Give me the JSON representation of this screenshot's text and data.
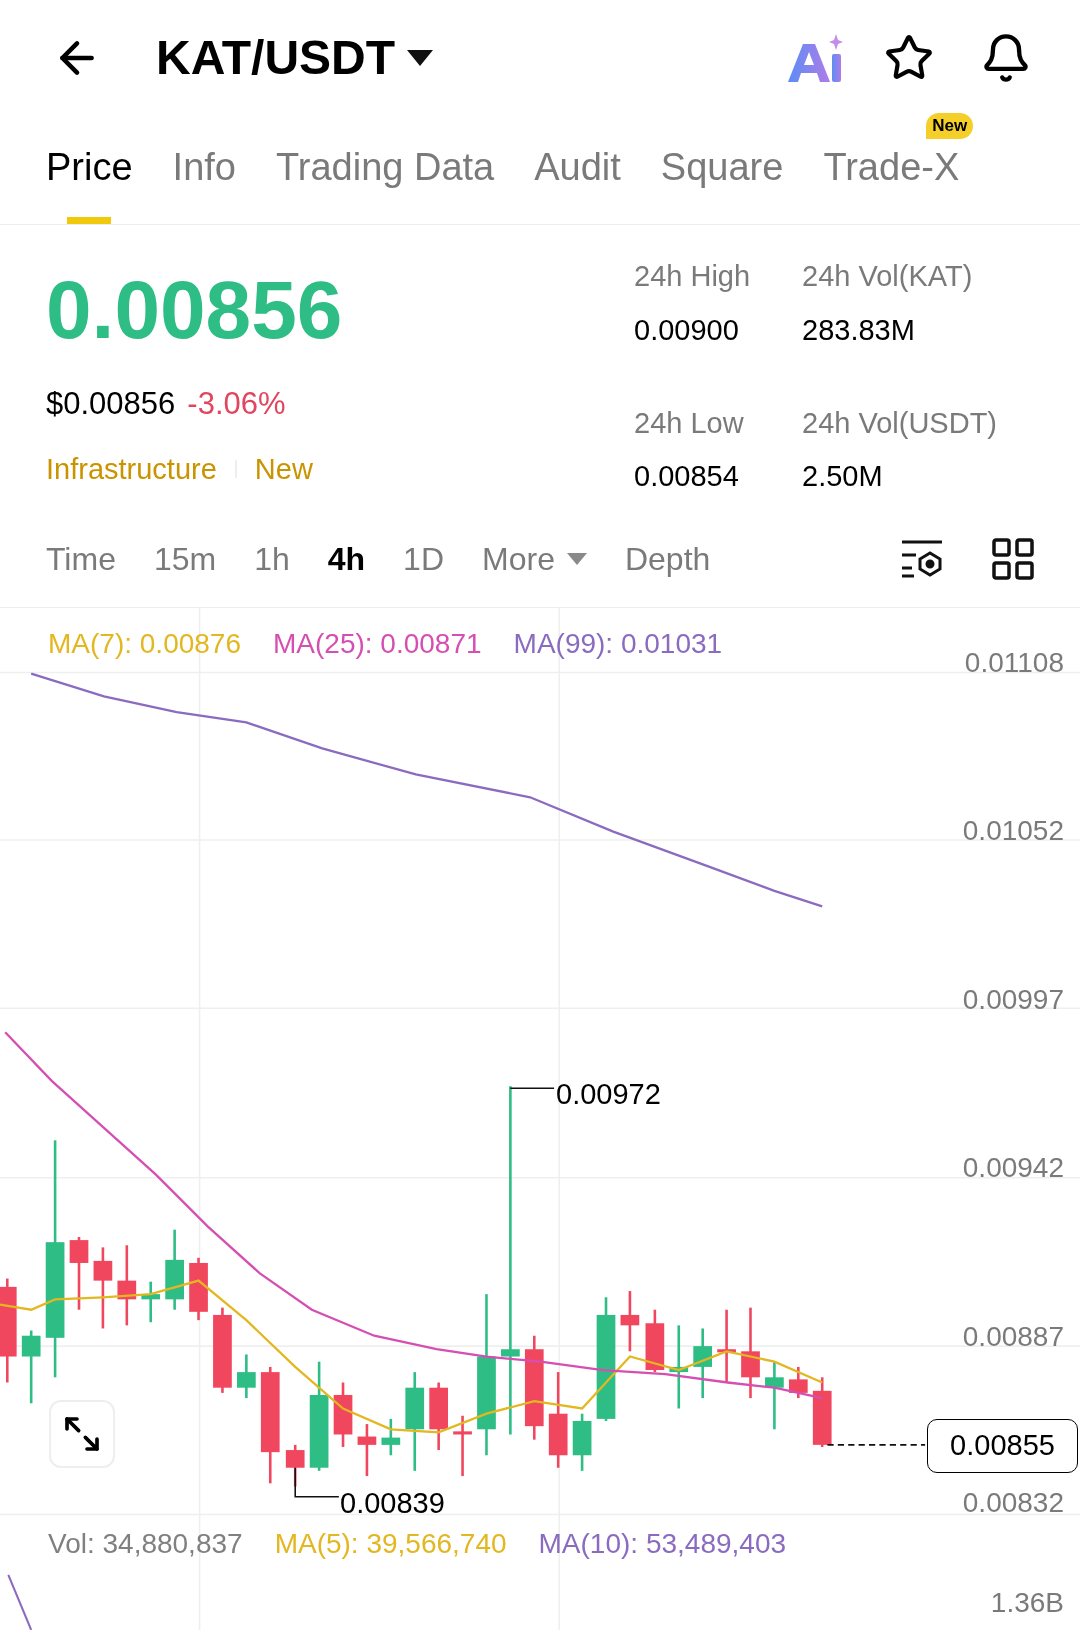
{
  "header": {
    "title": "KAT/USDT"
  },
  "tabs": [
    {
      "label": "Price",
      "selected": true
    },
    {
      "label": "Info",
      "selected": false
    },
    {
      "label": "Trading Data",
      "selected": false
    },
    {
      "label": "Audit",
      "selected": false
    },
    {
      "label": "Square",
      "selected": false
    },
    {
      "label": "Trade-X",
      "selected": false,
      "badge": "New"
    }
  ],
  "ticker": {
    "price": "0.00856",
    "usd_price": "$0.00856",
    "change": "-3.06%",
    "tags": [
      "Infrastructure",
      "New"
    ]
  },
  "stats": [
    {
      "label": "24h High",
      "value": "0.00900"
    },
    {
      "label": "24h Vol(KAT)",
      "value": "283.83M"
    },
    {
      "label": "24h Low",
      "value": "0.00854"
    },
    {
      "label": "24h Vol(USDT)",
      "value": "2.50M"
    }
  ],
  "intervals": [
    {
      "label": "Time",
      "kind": "plain",
      "selected": false
    },
    {
      "label": "15m",
      "kind": "plain",
      "selected": false
    },
    {
      "label": "1h",
      "kind": "plain",
      "selected": false
    },
    {
      "label": "4h",
      "kind": "plain",
      "selected": true
    },
    {
      "label": "1D",
      "kind": "plain",
      "selected": false
    },
    {
      "label": "More",
      "kind": "dropdown",
      "selected": false
    },
    {
      "label": "Depth",
      "kind": "plain",
      "selected": false
    }
  ],
  "chart": {
    "ma_legend": [
      {
        "label": "MA(7): 0.00876",
        "color": "#e2b71f"
      },
      {
        "label": "MA(25): 0.00871",
        "color": "#d54fb3"
      },
      {
        "label": "MA(99): 0.01031",
        "color": "#8a6bbf"
      }
    ],
    "price_axis": [
      "0.01108",
      "0.01052",
      "0.00997",
      "0.00942",
      "0.00887",
      "0.00832"
    ],
    "high_mark": "0.00972",
    "low_mark": "0.00839",
    "last_price": "0.00855",
    "volume_legend": [
      {
        "label": "Vol: 34,880,837",
        "color": "#808080"
      },
      {
        "label": "MA(5): 39,566,740",
        "color": "#e2b71f"
      },
      {
        "label": "MA(10): 53,489,403",
        "color": "#8a6bbf"
      }
    ],
    "volume_axis": "1.36B"
  }
}
